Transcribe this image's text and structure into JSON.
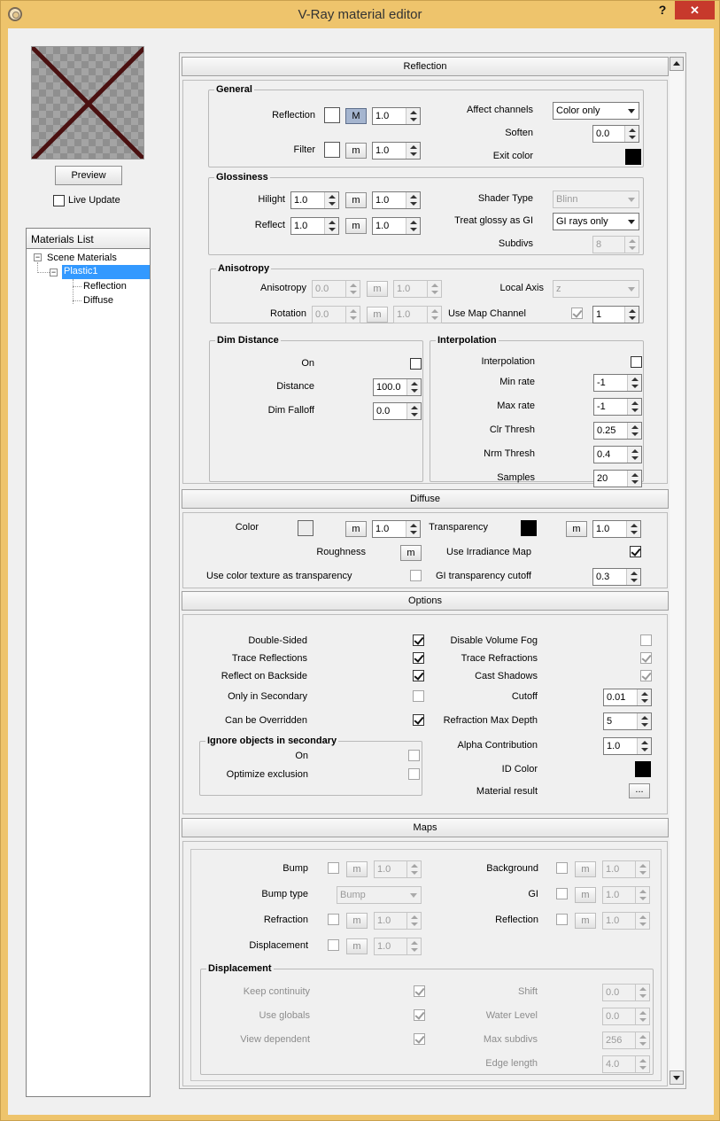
{
  "window": {
    "title": "V-Ray material editor",
    "help": "?",
    "close": "✕"
  },
  "left": {
    "preview_button": "Preview",
    "live_update": "Live Update",
    "materials_list_header": "Materials List",
    "tree": [
      {
        "label": "Scene Materials"
      },
      {
        "label": "Plastic1"
      },
      {
        "label": "Reflection"
      },
      {
        "label": "Diffuse"
      }
    ]
  },
  "reflection": {
    "header": "Reflection",
    "general": {
      "title": "General",
      "reflection": "Reflection",
      "reflection_m": "M",
      "reflection_val": "1.0",
      "filter": "Filter",
      "filter_m": "m",
      "filter_val": "1.0",
      "affect_channels": "Affect channels",
      "affect_channels_val": "Color only",
      "soften": "Soften",
      "soften_val": "0.0",
      "exit_color": "Exit color"
    },
    "glossiness": {
      "title": "Glossiness",
      "hilight": "Hilight",
      "hilight_val": "1.0",
      "hilight_m": "m",
      "hilight_mval": "1.0",
      "reflect": "Reflect",
      "reflect_val": "1.0",
      "reflect_m": "m",
      "reflect_mval": "1.0",
      "shader_type": "Shader Type",
      "shader_type_val": "Blinn",
      "treat_glossy": "Treat glossy as GI",
      "treat_glossy_val": "GI rays only",
      "subdivs": "Subdivs",
      "subdivs_val": "8"
    },
    "anisotropy": {
      "title": "Anisotropy",
      "anisotropy": "Anisotropy",
      "anisotropy_val": "0.0",
      "anisotropy_m": "m",
      "anisotropy_mval": "1.0",
      "local_axis": "Local Axis",
      "local_axis_val": "z",
      "rotation": "Rotation",
      "rotation_val": "0.0",
      "rotation_m": "m",
      "rotation_mval": "1.0",
      "use_map_channel": "Use Map Channel",
      "map_channel_val": "1"
    },
    "dim_distance": {
      "title": "Dim Distance",
      "on": "On",
      "distance": "Distance",
      "distance_val": "100.0",
      "dim_falloff": "Dim Falloff",
      "dim_falloff_val": "0.0"
    },
    "interpolation": {
      "title": "Interpolation",
      "interpolation": "Interpolation",
      "min_rate": "Min rate",
      "min_rate_val": "-1",
      "max_rate": "Max rate",
      "max_rate_val": "-1",
      "clr_thresh": "Clr Thresh",
      "clr_thresh_val": "0.25",
      "nrm_thresh": "Nrm Thresh",
      "nrm_thresh_val": "0.4",
      "samples": "Samples",
      "samples_val": "20"
    }
  },
  "diffuse": {
    "header": "Diffuse",
    "color": "Color",
    "color_m": "m",
    "color_val": "1.0",
    "transparency": "Transparency",
    "transparency_m": "m",
    "transparency_val": "1.0",
    "roughness": "Roughness",
    "roughness_m": "m",
    "use_irradiance": "Use Irradiance Map",
    "use_color_texture": "Use color texture as transparency",
    "gi_cutoff": "GI transparency cutoff",
    "gi_cutoff_val": "0.3"
  },
  "options": {
    "header": "Options",
    "double_sided": "Double-Sided",
    "trace_reflections": "Trace Reflections",
    "reflect_backside": "Reflect on Backside",
    "only_secondary": "Only in Secondary",
    "can_be_overridden": "Can be Overridden",
    "disable_volume_fog": "Disable Volume Fog",
    "trace_refractions": "Trace Refractions",
    "cast_shadows": "Cast Shadows",
    "cutoff": "Cutoff",
    "cutoff_val": "0.01",
    "refraction_max_depth": "Refraction Max Depth",
    "refraction_max_depth_val": "5",
    "alpha_contribution": "Alpha Contribution",
    "alpha_contribution_val": "1.0",
    "id_color": "ID Color",
    "material_result": "Material result",
    "material_result_btn": "...",
    "ignore": {
      "title": "Ignore objects in secondary",
      "on": "On",
      "optimize": "Optimize exclusion"
    }
  },
  "maps": {
    "header": "Maps",
    "bump": "Bump",
    "bump_m": "m",
    "bump_val": "1.0",
    "bump_type": "Bump type",
    "bump_type_val": "Bump",
    "refraction": "Refraction",
    "refraction_m": "m",
    "refraction_val": "1.0",
    "displacement": "Displacement",
    "displacement_m": "m",
    "displacement_val": "1.0",
    "background": "Background",
    "background_m": "m",
    "background_val": "1.0",
    "gi": "GI",
    "gi_m": "m",
    "gi_val": "1.0",
    "reflection": "Reflection",
    "reflection_m": "m",
    "reflection_val": "1.0",
    "disp": {
      "title": "Displacement",
      "keep_continuity": "Keep continuity",
      "use_globals": "Use globals",
      "view_dependent": "View dependent",
      "shift": "Shift",
      "shift_val": "0.0",
      "water_level": "Water Level",
      "water_level_val": "0.0",
      "max_subdivs": "Max subdivs",
      "max_subdivs_val": "256",
      "edge_length": "Edge length",
      "edge_length_val": "4.0"
    }
  },
  "colors": {
    "title_bar": "#eec46c",
    "close": "#c7392c",
    "selection": "#3399ff",
    "m_active": "#a5b5cf"
  }
}
